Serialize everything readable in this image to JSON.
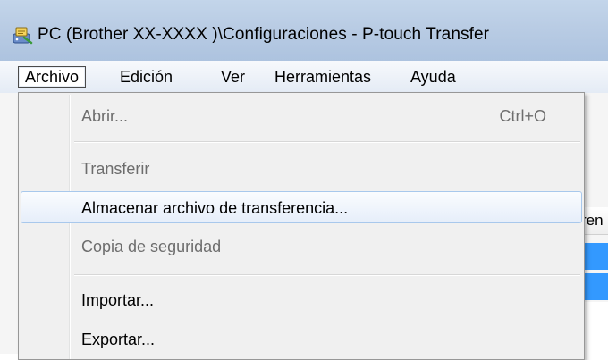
{
  "window": {
    "title": "PC (Brother  XX-XXXX )\\Configuraciones - P-touch Transfer",
    "icon": "p-touch-transfer-icon"
  },
  "menubar": {
    "items": [
      {
        "label": "Archivo",
        "open": true
      },
      {
        "label": "Edición"
      },
      {
        "label": "Ver"
      },
      {
        "label": "Herramientas"
      },
      {
        "label": "Ayuda"
      }
    ]
  },
  "archivo_menu": {
    "items": [
      {
        "label": "Abrir...",
        "shortcut": "Ctrl+O",
        "enabled": false
      },
      {
        "label": "Transferir",
        "enabled": false
      },
      {
        "label": "Almacenar archivo de transferencia...",
        "enabled": true,
        "highlighted": true
      },
      {
        "label": "Copia de seguridad",
        "enabled": false
      },
      {
        "label": "Importar...",
        "enabled": true
      },
      {
        "label": "Exportar...",
        "enabled": true
      }
    ]
  },
  "background": {
    "column_header_fragment": "ren"
  },
  "colors": {
    "selection_blue": "#3399ff",
    "menu_hover_border": "#a8c8ec",
    "disabled_text": "#6d6d6d"
  }
}
